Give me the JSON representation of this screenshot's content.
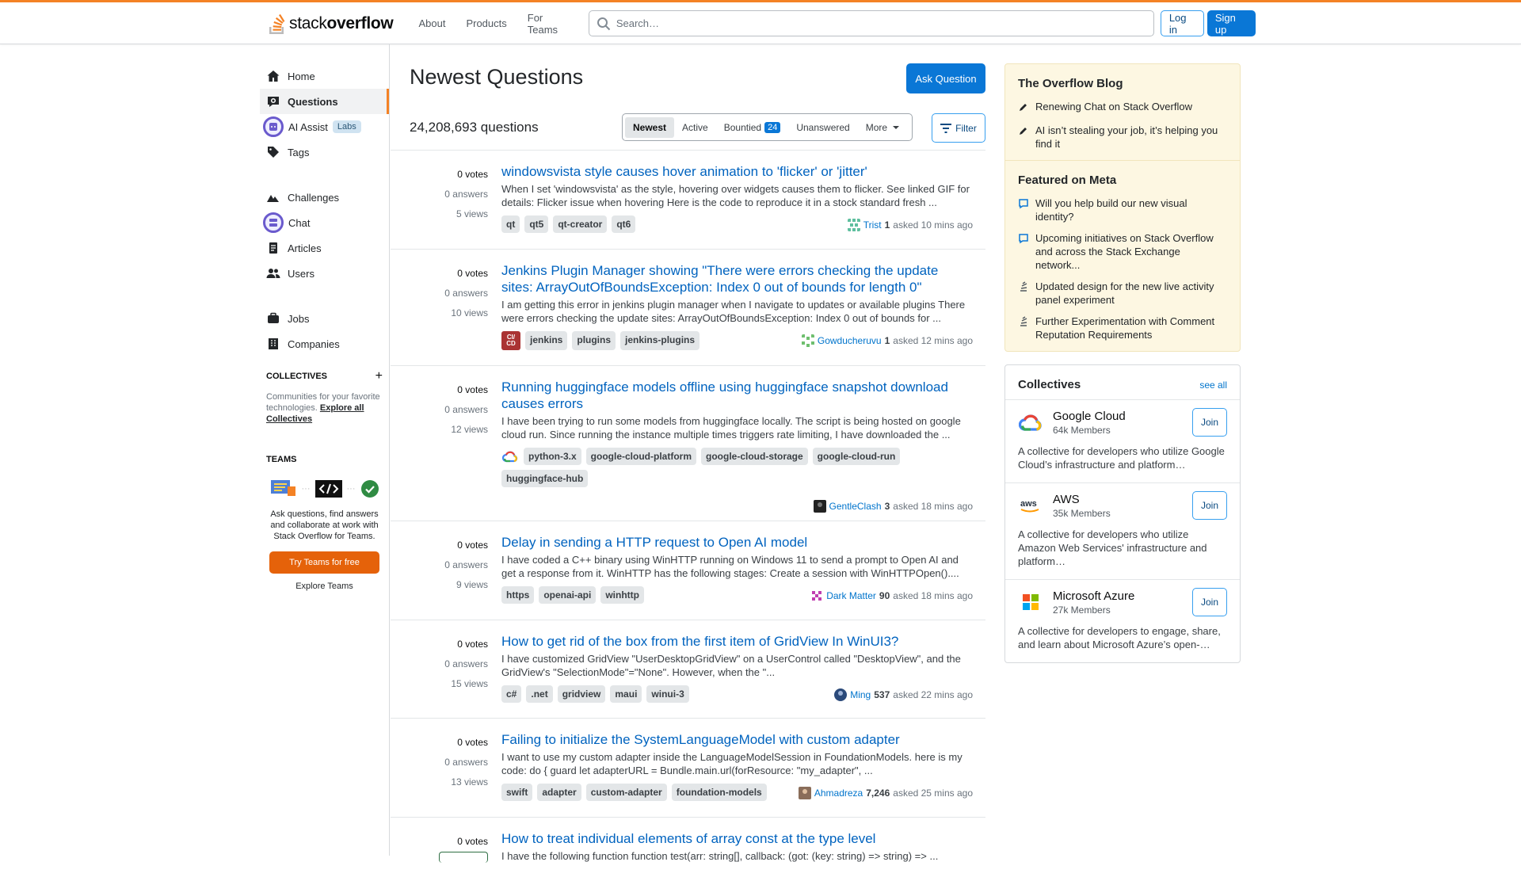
{
  "header": {
    "logo_text_light": "stack",
    "logo_text_bold": "overflow",
    "nav": [
      "About",
      "Products",
      "For Teams"
    ],
    "search_placeholder": "Search…",
    "login_label": "Log in",
    "signup_label": "Sign up"
  },
  "sidebar": {
    "items": [
      {
        "label": "Home",
        "icon": "home-icon"
      },
      {
        "label": "Questions",
        "icon": "questions-icon"
      },
      {
        "label": "AI Assist",
        "icon": "ai-assist-icon",
        "badge": "Labs"
      },
      {
        "label": "Tags",
        "icon": "tag-icon"
      },
      {
        "label": "Challenges",
        "icon": "challenges-icon"
      },
      {
        "label": "Chat",
        "icon": "chat-icon"
      },
      {
        "label": "Articles",
        "icon": "article-icon"
      },
      {
        "label": "Users",
        "icon": "users-icon"
      },
      {
        "label": "Jobs",
        "icon": "briefcase-icon"
      },
      {
        "label": "Companies",
        "icon": "building-icon"
      }
    ],
    "collectives_title": "COLLECTIVES",
    "collectives_desc": "Communities for your favorite technologies.",
    "collectives_link": "Explore all Collectives",
    "teams_title": "TEAMS",
    "teams_desc": "Ask questions, find answers and collaborate at work with Stack Overflow for Teams.",
    "teams_button": "Try Teams for free",
    "teams_link": "Explore Teams"
  },
  "main": {
    "title": "Newest Questions",
    "ask_button": "Ask Question",
    "count": "24,208,693 questions",
    "tabs": {
      "newest": "Newest",
      "active": "Active",
      "bountied": "Bountied",
      "bountied_count": "24",
      "unanswered": "Unanswered",
      "more": "More"
    },
    "filter_label": "Filter",
    "questions": [
      {
        "votes": "0 votes",
        "answers": "0 answers",
        "views": "5 views",
        "title": "windowsvista style causes hover animation to 'flicker' or 'jitter'",
        "excerpt": "When I set 'windowsvista' as the style, hovering over widgets causes them to flicker. See linked GIF for details: Flicker issue when hovering Here is the code to reproduce it in a stock standard fresh ...",
        "tags": [
          "qt",
          "qt5",
          "qt-creator",
          "qt6"
        ],
        "user": "Trist",
        "rep": "1",
        "time": "asked 10 mins ago"
      },
      {
        "votes": "0 votes",
        "answers": "0 answers",
        "views": "10 views",
        "title": "Jenkins Plugin Manager showing \"There were errors checking the update sites: ArrayOutOfBoundsException: Index 0 out of bounds for length 0\"",
        "excerpt": "I am getting this error in jenkins plugin manager when I navigate to updates or available plugins There were errors checking the update sites: ArrayOutOfBoundsException: Index 0 out of bounds for ...",
        "tag_icon_text": "CI/CD",
        "tags": [
          "jenkins",
          "plugins",
          "jenkins-plugins"
        ],
        "user": "Gowducheruvu",
        "rep": "1",
        "time": "asked 12 mins ago"
      },
      {
        "votes": "0 votes",
        "answers": "0 answers",
        "views": "12 views",
        "title": "Running huggingface models offline using huggingface snapshot download causes errors",
        "excerpt": "I have been trying to run some models from huggingface locally. The script is being hosted on google cloud run. Since running the instance multiple times triggers rate limiting, I have downloaded the ...",
        "tags": [
          "python-3.x",
          "google-cloud-platform",
          "google-cloud-storage",
          "google-cloud-run",
          "huggingface-hub"
        ],
        "user": "GentleClash",
        "rep": "3",
        "time": "asked 18 mins ago"
      },
      {
        "votes": "0 votes",
        "answers": "0 answers",
        "views": "9 views",
        "title": "Delay in sending a HTTP request to Open AI model",
        "excerpt": "I have coded a C++ binary using WinHTTP running on Windows 11 to send a prompt to Open AI and get a response from it. WinHTTP has the following stages: Create a session with WinHTTPOpen()....",
        "tags": [
          "https",
          "openai-api",
          "winhttp"
        ],
        "user": "Dark Matter",
        "rep": "90",
        "time": "asked 18 mins ago"
      },
      {
        "votes": "0 votes",
        "answers": "0 answers",
        "views": "15 views",
        "title": "How to get rid of the box from the first item of GridView In WinUI3?",
        "excerpt": "I have customized GridView \"UserDesktopGridView\" on a UserControl called \"DesktopView\", and the GridView's \"SelectionMode\"=\"None\". However, when the \"...",
        "tags": [
          "c#",
          ".net",
          "gridview",
          "maui",
          "winui-3"
        ],
        "user": "Ming",
        "rep": "537",
        "time": "asked 22 mins ago"
      },
      {
        "votes": "0 votes",
        "answers": "0 answers",
        "views": "13 views",
        "title": "Failing to initialize the SystemLanguageModel with custom adapter",
        "excerpt": "I want to use my custom adapter inside the LanguageModelSession in FoundationModels. here is my code: do { guard let adapterURL = Bundle.main.url(forResource: \"my_adapter\", ...",
        "tags": [
          "swift",
          "adapter",
          "custom-adapter",
          "foundation-models"
        ],
        "user": "Ahmadreza",
        "rep": "7,246",
        "time": "asked 25 mins ago"
      },
      {
        "votes": "0 votes",
        "answers": "",
        "views": "",
        "title": "How to treat individual elements of array const at the type level",
        "excerpt": "I have the following function function test(arr: string[], callback: (got: (key: string) => string) => ...",
        "tags": [],
        "user": "",
        "rep": "",
        "time": ""
      }
    ]
  },
  "right": {
    "blog_title": "The Overflow Blog",
    "blog_items": [
      "Renewing Chat on Stack Overflow",
      "AI isn’t stealing your job, it’s helping you find it"
    ],
    "meta_title": "Featured on Meta",
    "meta_items": [
      "Will you help build our new visual identity?",
      "Upcoming initiatives on Stack Overflow and across the Stack Exchange network...",
      "Updated design for the new live activity panel experiment",
      "Further Experimentation with Comment Reputation Requirements"
    ],
    "collectives_title": "Collectives",
    "see_all": "see all",
    "collectives": [
      {
        "name": "Google Cloud",
        "members": "64k Members",
        "desc": "A collective for developers who utilize Google Cloud’s infrastructure and platform…",
        "join": "Join"
      },
      {
        "name": "AWS",
        "members": "35k Members",
        "desc": "A collective for developers who utilize Amazon Web Services' infrastructure and platform…",
        "join": "Join"
      },
      {
        "name": "Microsoft Azure",
        "members": "27k Members",
        "desc": "A collective for developers to engage, share, and learn about Microsoft Azure’s open-…",
        "join": "Join"
      }
    ]
  },
  "colors": {
    "accent_orange": "#f48225",
    "link_blue": "#0063bf",
    "button_blue": "#0a77d6",
    "blog_bg": "#fdf7e2"
  }
}
